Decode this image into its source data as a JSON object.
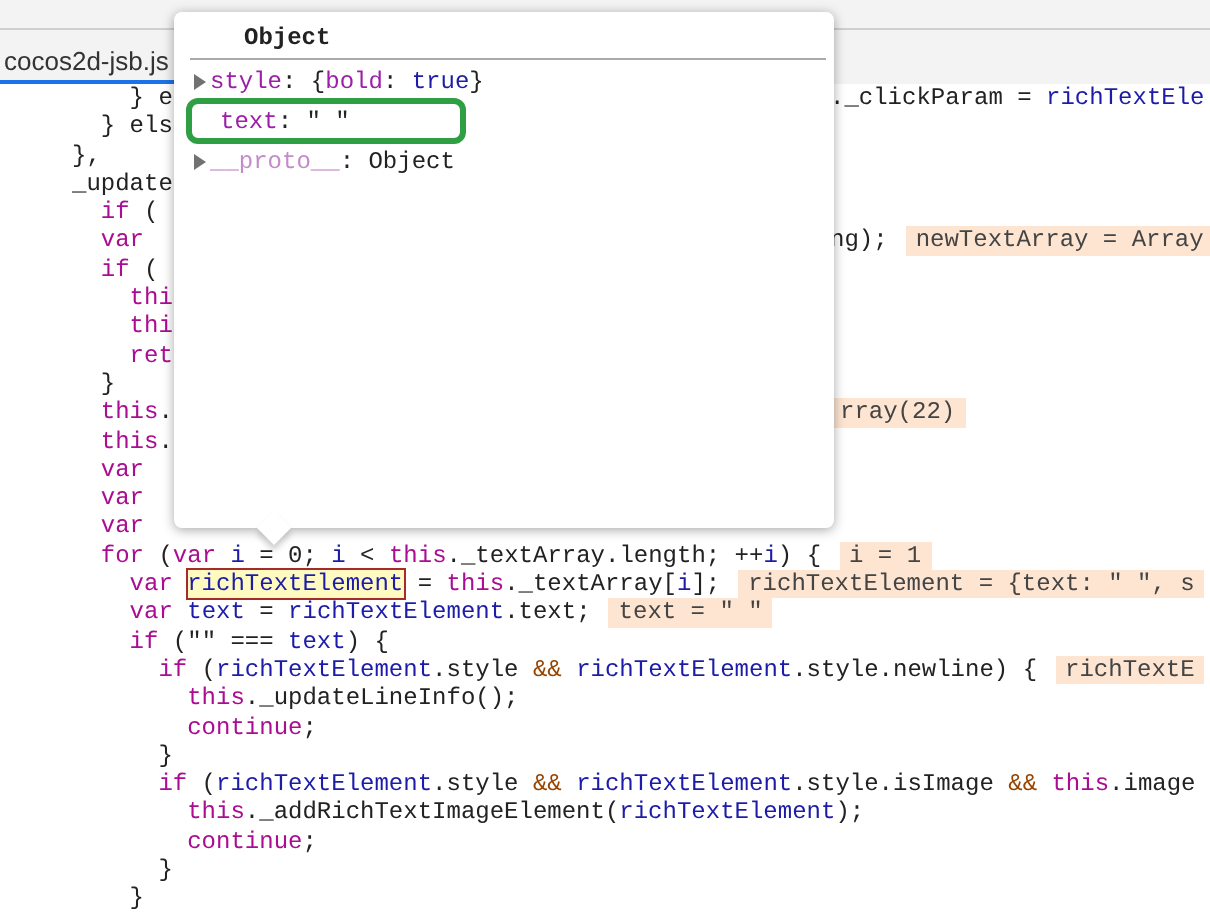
{
  "tab": {
    "label": "cocos2d-jsb.js",
    "selected": true
  },
  "code_lines": [
    {
      "kind": "covered",
      "code": [
        {
          "kind": "plain",
          "text": "    } e"
        }
      ],
      "right": [
        {
          "kind": "plain",
          "text": "._clickParam = "
        },
        {
          "kind": "ident",
          "text": "richTextEle"
        }
      ]
    },
    {
      "kind": "full",
      "code": [
        {
          "kind": "plain",
          "text": "  } els"
        }
      ]
    },
    {
      "kind": "full",
      "code": [
        {
          "kind": "plain",
          "text": "},"
        }
      ]
    },
    {
      "kind": "full",
      "code": [
        {
          "kind": "plain",
          "text": "_update"
        }
      ]
    },
    {
      "kind": "full",
      "code": [
        {
          "kind": "keyword",
          "text": "  if"
        },
        {
          "kind": "plain",
          "text": " ("
        }
      ]
    },
    {
      "kind": "covered",
      "code": [
        {
          "kind": "keyword",
          "text": "  var"
        }
      ],
      "right": [
        {
          "kind": "plain",
          "text": "ng);"
        }
      ],
      "value": "newTextArray = Array"
    },
    {
      "kind": "full",
      "code": [
        {
          "kind": "keyword",
          "text": "  if"
        },
        {
          "kind": "plain",
          "text": " ("
        }
      ]
    },
    {
      "kind": "full",
      "code": [
        {
          "kind": "keyword",
          "text": "    thi"
        }
      ]
    },
    {
      "kind": "full",
      "code": [
        {
          "kind": "keyword",
          "text": "    thi"
        }
      ]
    },
    {
      "kind": "full",
      "code": [
        {
          "kind": "keyword",
          "text": "    ret"
        }
      ]
    },
    {
      "kind": "full",
      "code": [
        {
          "kind": "plain",
          "text": "  }"
        }
      ]
    },
    {
      "kind": "covered",
      "code": [
        {
          "kind": "keyword",
          "text": "  this"
        },
        {
          "kind": "plain",
          "text": "."
        }
      ],
      "value": "rray(22)"
    },
    {
      "kind": "full",
      "code": [
        {
          "kind": "keyword",
          "text": "  this"
        },
        {
          "kind": "plain",
          "text": "."
        }
      ]
    },
    {
      "kind": "full",
      "code": [
        {
          "kind": "keyword",
          "text": "  var"
        }
      ]
    },
    {
      "kind": "full",
      "code": [
        {
          "kind": "keyword",
          "text": "  var"
        }
      ]
    },
    {
      "kind": "full",
      "code": [
        {
          "kind": "keyword",
          "text": "  var"
        }
      ]
    },
    {
      "kind": "full",
      "code": [
        {
          "kind": "keyword",
          "text": "  for"
        },
        {
          "kind": "plain",
          "text": " ("
        },
        {
          "kind": "keyword",
          "text": "var"
        },
        {
          "kind": "ident",
          "text": " i"
        },
        {
          "kind": "plain",
          "text": " = 0; "
        },
        {
          "kind": "ident",
          "text": "i"
        },
        {
          "kind": "plain",
          "text": " < "
        },
        {
          "kind": "keyword",
          "text": "this"
        },
        {
          "kind": "plain",
          "text": "._textArray.length; ++"
        },
        {
          "kind": "ident",
          "text": "i"
        },
        {
          "kind": "plain",
          "text": ") {"
        }
      ],
      "value": "i = 1"
    },
    {
      "kind": "full",
      "code": [
        {
          "kind": "keyword",
          "text": "    var "
        },
        {
          "kind": "hover",
          "text": "richTextElement"
        },
        {
          "kind": "plain",
          "text": " = "
        },
        {
          "kind": "keyword",
          "text": "this"
        },
        {
          "kind": "plain",
          "text": "._textArray["
        },
        {
          "kind": "ident",
          "text": "i"
        },
        {
          "kind": "plain",
          "text": "];"
        }
      ],
      "value": "richTextElement = {text: \" \", s"
    },
    {
      "kind": "full",
      "code": [
        {
          "kind": "keyword",
          "text": "    var"
        },
        {
          "kind": "ident",
          "text": " text"
        },
        {
          "kind": "plain",
          "text": " = "
        },
        {
          "kind": "ident",
          "text": "richTextElement"
        },
        {
          "kind": "plain",
          "text": ".text;"
        }
      ],
      "value": "text = \" \""
    },
    {
      "kind": "full",
      "code": [
        {
          "kind": "keyword",
          "text": "    if"
        },
        {
          "kind": "plain",
          "text": " (\"\" === "
        },
        {
          "kind": "ident",
          "text": "text"
        },
        {
          "kind": "plain",
          "text": ") {"
        }
      ]
    },
    {
      "kind": "full",
      "code": [
        {
          "kind": "keyword",
          "text": "      if"
        },
        {
          "kind": "plain",
          "text": " ("
        },
        {
          "kind": "ident",
          "text": "richTextElement"
        },
        {
          "kind": "plain",
          "text": ".style "
        },
        {
          "kind": "operator",
          "text": "&&"
        },
        {
          "kind": "ident",
          "text": " richTextElement"
        },
        {
          "kind": "plain",
          "text": ".style.newline) {"
        }
      ],
      "value": "richTextE"
    },
    {
      "kind": "full",
      "code": [
        {
          "kind": "keyword",
          "text": "        this"
        },
        {
          "kind": "plain",
          "text": "._updateLineInfo();"
        }
      ]
    },
    {
      "kind": "full",
      "code": [
        {
          "kind": "keyword",
          "text": "        continue"
        },
        {
          "kind": "plain",
          "text": ";"
        }
      ]
    },
    {
      "kind": "full",
      "code": [
        {
          "kind": "plain",
          "text": "      }"
        }
      ]
    },
    {
      "kind": "full",
      "code": [
        {
          "kind": "keyword",
          "text": "      if"
        },
        {
          "kind": "plain",
          "text": " ("
        },
        {
          "kind": "ident",
          "text": "richTextElement"
        },
        {
          "kind": "plain",
          "text": ".style "
        },
        {
          "kind": "operator",
          "text": "&&"
        },
        {
          "kind": "ident",
          "text": " richTextElement"
        },
        {
          "kind": "plain",
          "text": ".style.isImage "
        },
        {
          "kind": "operator",
          "text": "&&"
        },
        {
          "kind": "keyword",
          "text": " this"
        },
        {
          "kind": "plain",
          "text": ".image"
        }
      ]
    },
    {
      "kind": "full",
      "code": [
        {
          "kind": "keyword",
          "text": "        this"
        },
        {
          "kind": "plain",
          "text": "._addRichTextImageElement("
        },
        {
          "kind": "ident",
          "text": "richTextElement"
        },
        {
          "kind": "plain",
          "text": ");"
        }
      ]
    },
    {
      "kind": "full",
      "code": [
        {
          "kind": "keyword",
          "text": "        continue"
        },
        {
          "kind": "plain",
          "text": ";"
        }
      ]
    },
    {
      "kind": "full",
      "code": [
        {
          "kind": "plain",
          "text": "      }"
        }
      ]
    },
    {
      "kind": "full",
      "code": [
        {
          "kind": "plain",
          "text": "    }"
        }
      ]
    }
  ],
  "popover": {
    "title": "Object",
    "properties": [
      {
        "name": "style",
        "value": [
          {
            "kind": "plain",
            "text": ": {"
          },
          {
            "kind": "keyword",
            "text": "bold"
          },
          {
            "kind": "plain",
            "text": ": "
          },
          {
            "kind": "ident",
            "text": "true"
          },
          {
            "kind": "plain",
            "text": "}"
          }
        ],
        "expandable": true,
        "internal": false,
        "highlighted": false
      },
      {
        "name": "text",
        "value": [
          {
            "kind": "plain",
            "text": ": \" \""
          }
        ],
        "expandable": false,
        "internal": false,
        "highlighted": true
      },
      {
        "name": "__proto__",
        "value": [
          {
            "kind": "plain",
            "text": ": Object"
          }
        ],
        "expandable": true,
        "internal": true,
        "highlighted": false
      }
    ]
  }
}
